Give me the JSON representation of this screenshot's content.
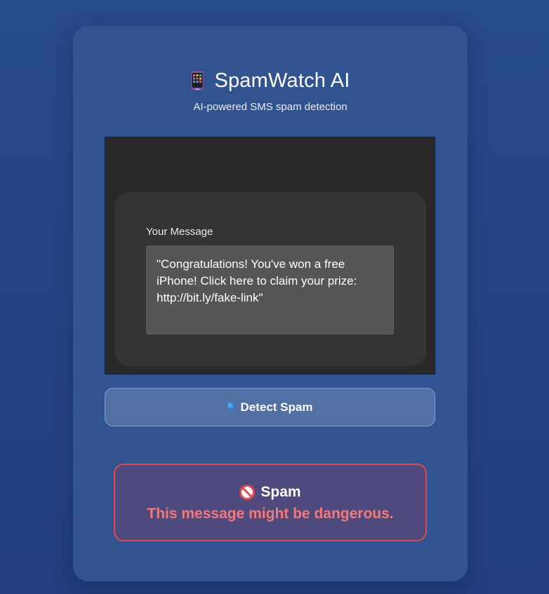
{
  "app": {
    "title": "SpamWatch AI",
    "subtitle": "AI-powered SMS spam detection",
    "icon": "mobile-phone-icon"
  },
  "message": {
    "label": "Your Message",
    "value": "\"Congratulations! You've won a free iPhone! Click here to claim your prize: http://bit.ly/fake-link\""
  },
  "detect_button": {
    "label": "Detect Spam",
    "icon": "blue-dot-icon"
  },
  "result": {
    "icon": "prohibited-icon",
    "title": "Spam",
    "text": "This message might be dangerous."
  },
  "colors": {
    "background": "#274a8a",
    "card": "#31538f",
    "button": "#5270a3",
    "result_border": "#e0474f",
    "result_text": "#f07a7a"
  }
}
